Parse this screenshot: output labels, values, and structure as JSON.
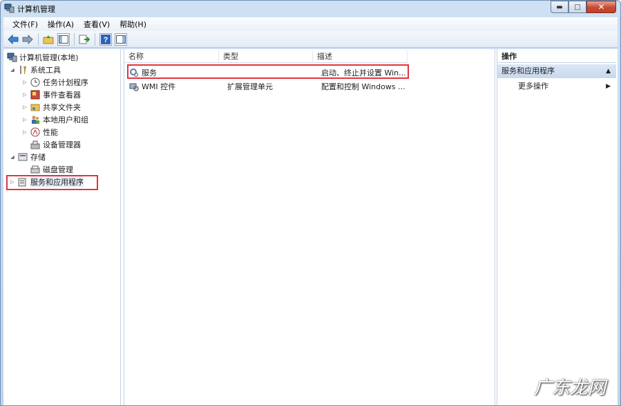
{
  "window": {
    "title": "计算机管理",
    "controls": {
      "minimize": "▬",
      "maximize": "□",
      "close": "✕"
    }
  },
  "menu": [
    "文件(F)",
    "操作(A)",
    "查看(V)",
    "帮助(H)"
  ],
  "toolbar": {
    "icons": [
      "back-icon",
      "forward-icon",
      "up-folder-icon",
      "show-hide-tree-icon",
      "export-list-icon",
      "help-icon",
      "show-hide-action-pane-icon"
    ]
  },
  "tree": {
    "root": "计算机管理(本地)",
    "system_tools": "系统工具",
    "task_scheduler": "任务计划程序",
    "event_viewer": "事件查看器",
    "shared_folders": "共享文件夹",
    "local_users": "本地用户和组",
    "performance": "性能",
    "device_manager": "设备管理器",
    "storage": "存储",
    "disk_management": "磁盘管理",
    "services_apps": "服务和应用程序"
  },
  "list": {
    "columns": [
      "名称",
      "类型",
      "描述"
    ],
    "rows": [
      {
        "name": "服务",
        "type": "",
        "desc": "启动、终止并设置 Win..."
      },
      {
        "name": "WMI 控件",
        "type": "扩展管理单元",
        "desc": "配置和控制 Windows ..."
      }
    ]
  },
  "actions": {
    "header": "操作",
    "section": "服务和应用程序",
    "section_arrow": "▲",
    "more": "更多操作",
    "more_arrow": "▶"
  },
  "watermark": "广东龙网",
  "colors": {
    "highlight_box": "#e2343b",
    "action_section_bg": "#c7d9ee"
  }
}
